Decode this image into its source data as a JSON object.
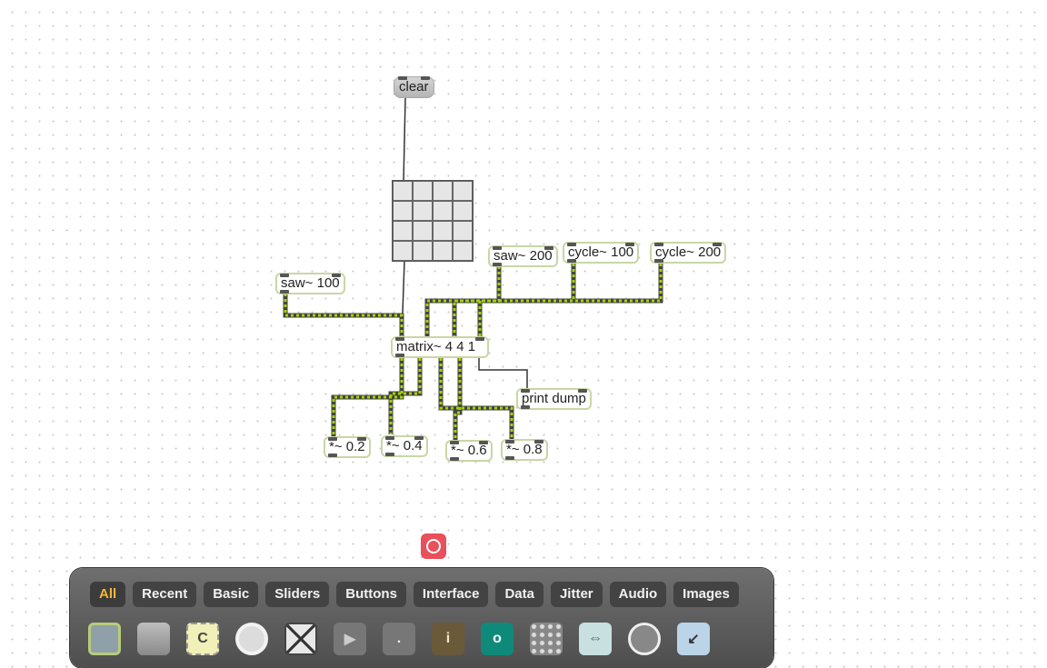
{
  "patch": {
    "objects": {
      "clear_msg": "clear",
      "saw100": "saw~ 100",
      "saw200": "saw~ 200",
      "cycle100": "cycle~ 100",
      "cycle200": "cycle~ 200",
      "matrix": "matrix~ 4 4 1",
      "print_dump": "print dump",
      "mul02": "*~ 0.2",
      "mul04": "*~ 0.4",
      "mul06": "*~ 0.6",
      "mul08": "*~ 0.8"
    },
    "matrixctrl": {
      "rows": 4,
      "columns": 4
    }
  },
  "colors": {
    "signal_cord": "#9ccc00",
    "control_cord": "#333333",
    "object_border": "#c9d6a6",
    "accent": "#f6b73c"
  },
  "palette": {
    "tabs": [
      "All",
      "Recent",
      "Basic",
      "Sliders",
      "Buttons",
      "Interface",
      "Data",
      "Jitter",
      "Audio",
      "Images"
    ],
    "active_tab": "All",
    "icons": [
      {
        "name": "bpatcher-icon",
        "glyph": ""
      },
      {
        "name": "panel-icon",
        "glyph": ""
      },
      {
        "name": "comment-icon",
        "glyph": "C"
      },
      {
        "name": "button-icon",
        "glyph": ""
      },
      {
        "name": "toggle-icon",
        "glyph": ""
      },
      {
        "name": "textbutton-icon",
        "glyph": ""
      },
      {
        "name": "flonum-icon",
        "glyph": "."
      },
      {
        "name": "info-icon",
        "glyph": "i"
      },
      {
        "name": "object-icon",
        "glyph": "o"
      },
      {
        "name": "matrixctrl-icon",
        "glyph": ""
      },
      {
        "name": "pictctrl-icon",
        "glyph": ""
      },
      {
        "name": "dial-icon",
        "glyph": ""
      },
      {
        "name": "inlet-icon",
        "glyph": ""
      }
    ]
  }
}
